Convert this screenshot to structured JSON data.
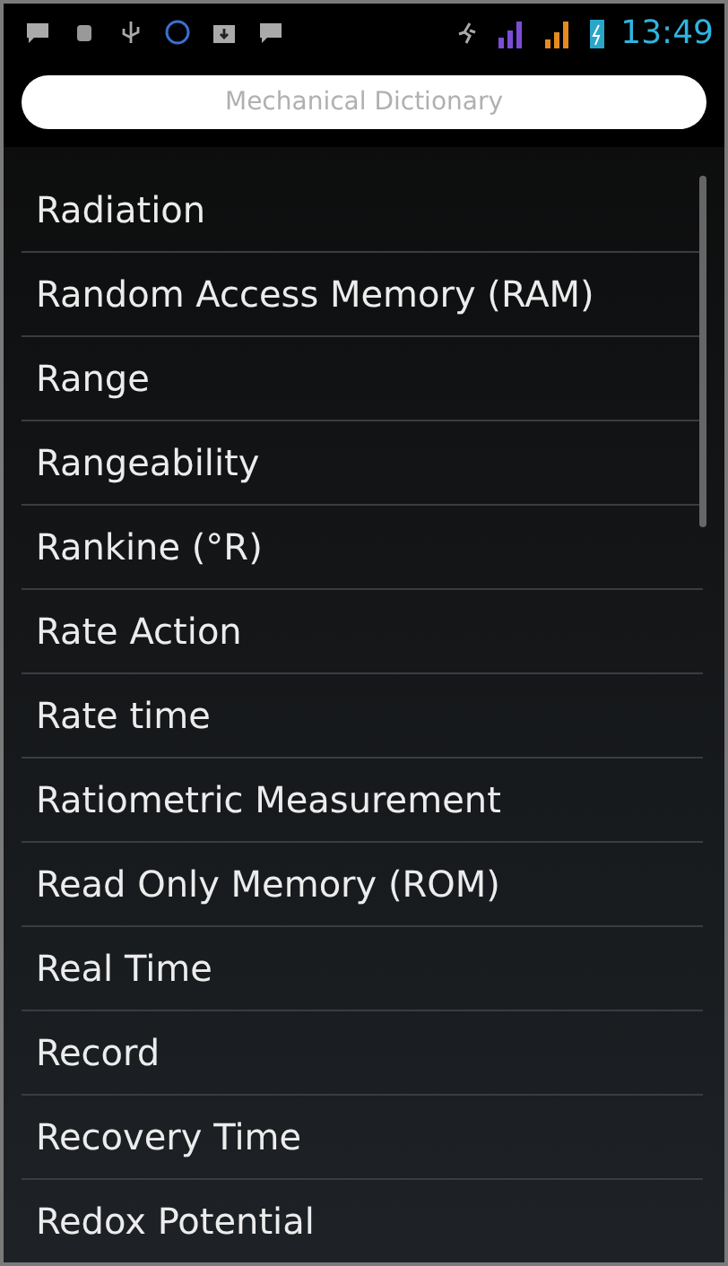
{
  "status_bar": {
    "time": "13:49"
  },
  "search": {
    "placeholder": "Mechanical Dictionary"
  },
  "terms": [
    "Radiation",
    "Random Access Memory (RAM)",
    "Range",
    "Rangeability",
    "Rankine (°R)",
    "Rate Action",
    "Rate time",
    "Ratiometric Measurement",
    "Read Only Memory (ROM)",
    "Real Time",
    "Record",
    "Recovery Time",
    "Redox Potential"
  ]
}
